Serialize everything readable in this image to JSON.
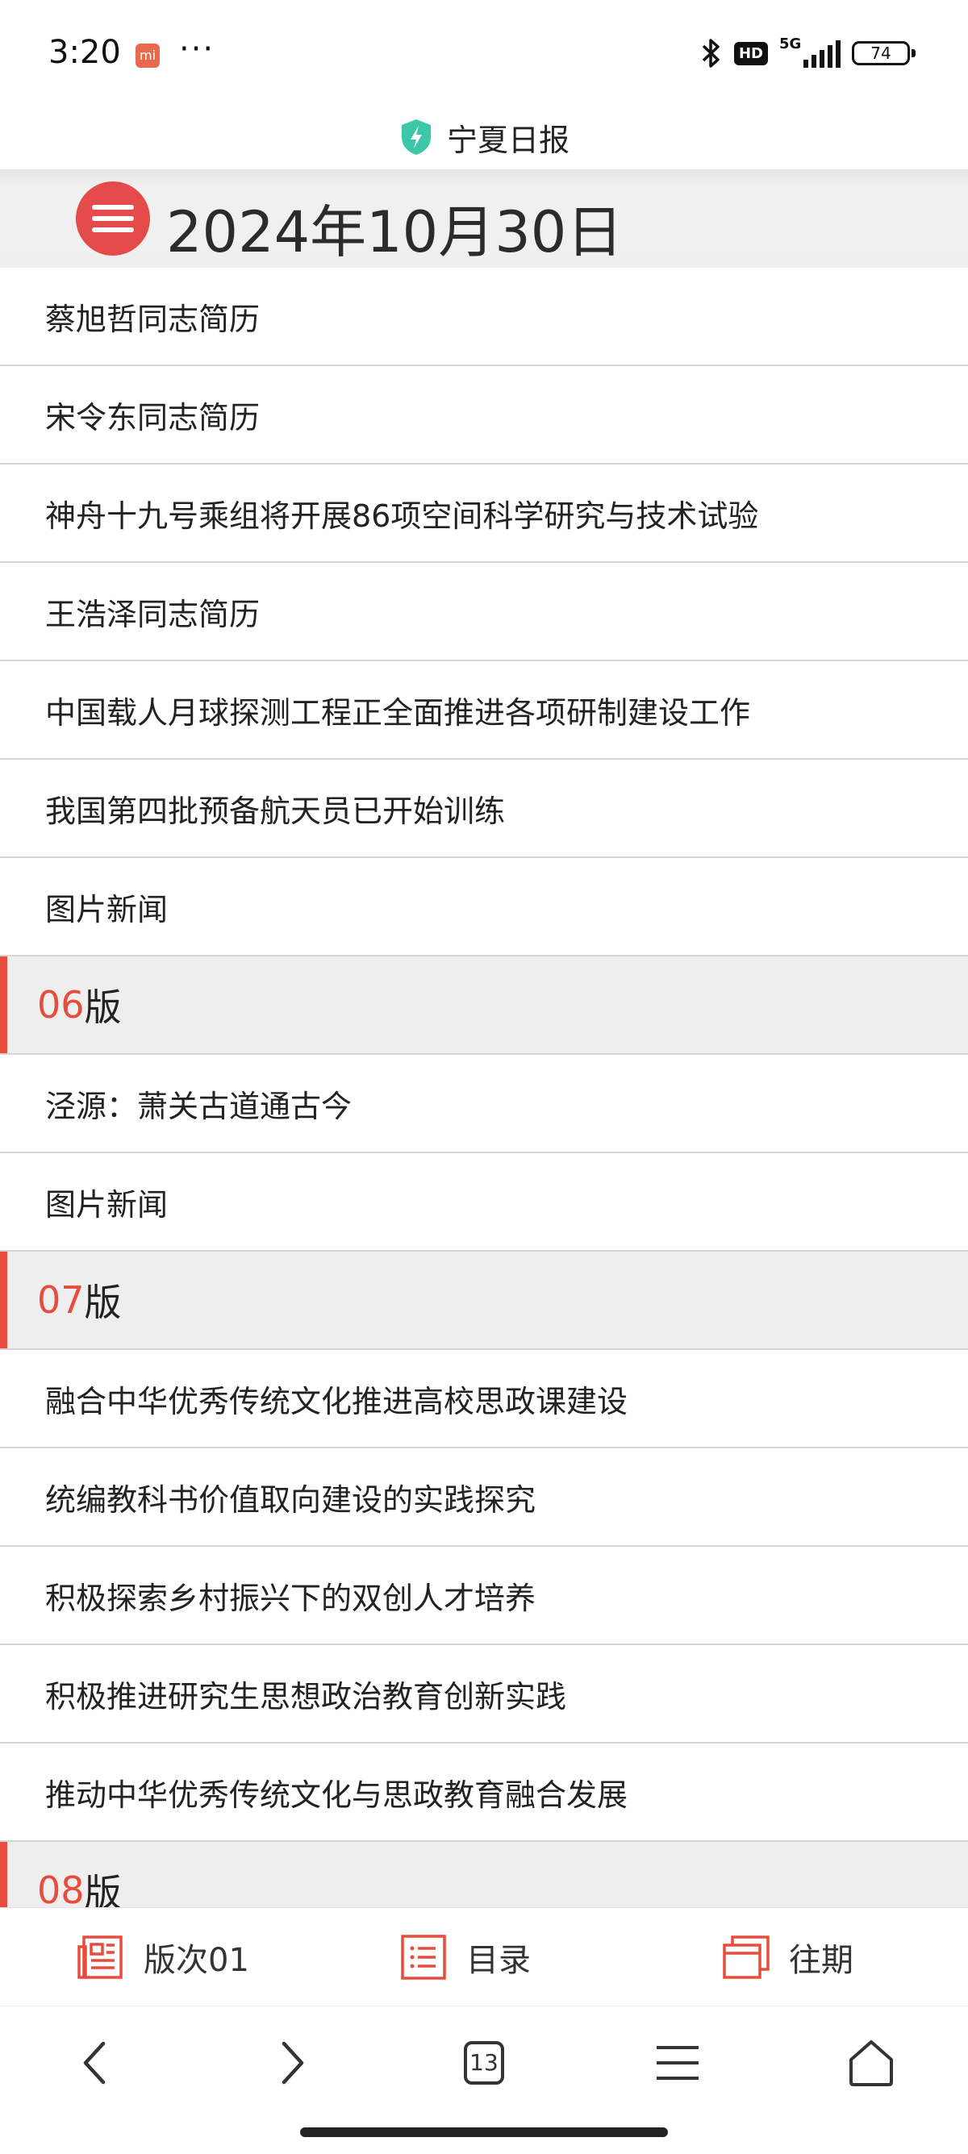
{
  "status_bar": {
    "time": "3:20",
    "more": "···",
    "hd": "HD",
    "network": "5G",
    "battery": "74"
  },
  "site": {
    "name": "宁夏日报"
  },
  "date_header": {
    "title": "2024年10月30日"
  },
  "list": {
    "articles_a": [
      "蔡旭哲同志简历",
      "宋令东同志简历",
      "神舟十九号乘组将开展86项空间科学研究与技术试验",
      "王浩泽同志简历",
      "中国载人月球探测工程正全面推进各项研制建设工作",
      "我国第四批预备航天员已开始训练",
      "图片新闻"
    ],
    "section_06": {
      "num": "06",
      "suffix": "版"
    },
    "articles_b": [
      "泾源：萧关古道通古今",
      "图片新闻"
    ],
    "section_07": {
      "num": "07",
      "suffix": "版"
    },
    "articles_c": [
      "融合中华优秀传统文化推进高校思政课建设",
      "统编教科书价值取向建设的实践探究",
      "积极探索乡村振兴下的双创人才培养",
      "积极推进研究生思想政治教育创新实践",
      "推动中华优秀传统文化与思政教育融合发展"
    ],
    "section_08": {
      "num": "08",
      "suffix": "版"
    }
  },
  "tabbar": {
    "edition": "版次01",
    "contents": "目录",
    "archive": "往期"
  },
  "navbar": {
    "tab_count": "13"
  },
  "colors": {
    "accent": "#e74c3c",
    "shield": "#3cc8a8"
  }
}
